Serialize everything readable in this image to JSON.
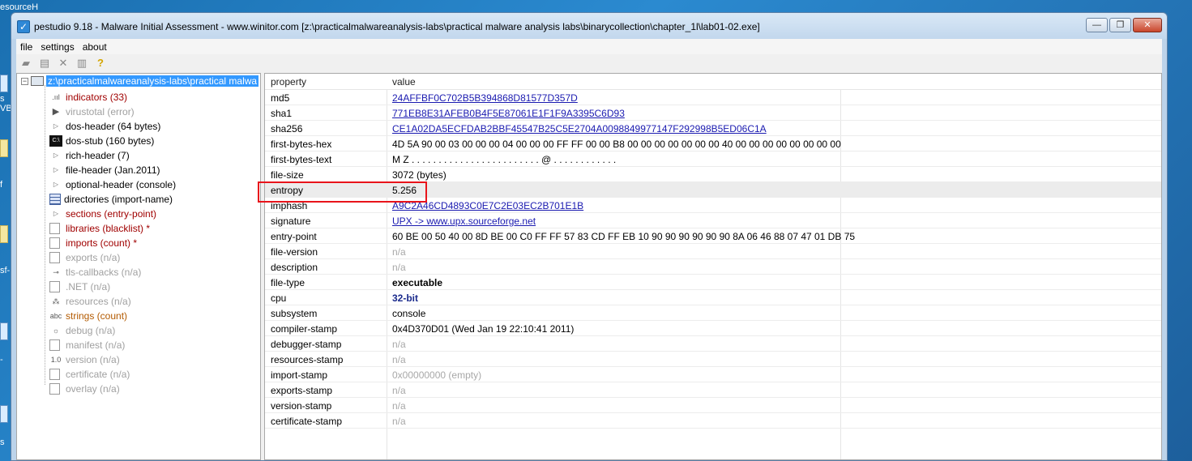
{
  "desktop": {
    "top_label": "esourceH",
    "side_labels": [
      "s",
      "VB",
      "f",
      "sf-",
      "-",
      "-",
      "s"
    ]
  },
  "window": {
    "title": "pestudio 9.18 - Malware Initial Assessment - www.winitor.com [z:\\practicalmalwareanalysis-labs\\practical malware analysis labs\\binarycollection\\chapter_1l\\lab01-02.exe]",
    "min_glyph": "—",
    "max_glyph": "❐",
    "close_glyph": "✕"
  },
  "menu": {
    "items": [
      "file",
      "settings",
      "about"
    ]
  },
  "toolbar": {
    "icons": [
      "open-icon",
      "save-icon",
      "close-file-icon",
      "clipboard-icon",
      "help-icon"
    ],
    "glyphs": [
      "▰",
      "▤",
      "✕",
      "▥",
      "?"
    ]
  },
  "tree": {
    "root_label": "z:\\practicalmalwareanalysis-labs\\practical malwa",
    "root_expander": "−",
    "items": [
      {
        "label": "indicators (33)",
        "color": "red",
        "icon": "bar-chart-icon",
        "glyph": ".ııl"
      },
      {
        "label": "virustotal (error)",
        "color": "gray",
        "icon": "virustotal-icon",
        "glyph": "▶"
      },
      {
        "label": "dos-header (64 bytes)",
        "color": "black",
        "icon": "chevron-right-icon",
        "glyph": "▷"
      },
      {
        "label": "dos-stub (160 bytes)",
        "color": "black",
        "icon": "console-icon",
        "glyph": "C:\\"
      },
      {
        "label": "rich-header (7)",
        "color": "black",
        "icon": "chevron-right-icon",
        "glyph": "▷"
      },
      {
        "label": "file-header (Jan.2011)",
        "color": "black",
        "icon": "chevron-right-icon",
        "glyph": "▷"
      },
      {
        "label": "optional-header (console)",
        "color": "black",
        "icon": "chevron-right-icon",
        "glyph": "▷"
      },
      {
        "label": "directories (import-name)",
        "color": "black",
        "icon": "grid-icon",
        "glyph": ""
      },
      {
        "label": "sections (entry-point)",
        "color": "red",
        "icon": "chevron-right-icon",
        "glyph": "▷"
      },
      {
        "label": "libraries (blacklist) *",
        "color": "red",
        "icon": "library-icon",
        "glyph": ""
      },
      {
        "label": "imports (count) *",
        "color": "red",
        "icon": "import-icon",
        "glyph": ""
      },
      {
        "label": "exports (n/a)",
        "color": "gray",
        "icon": "export-icon",
        "glyph": ""
      },
      {
        "label": "tls-callbacks (n/a)",
        "color": "gray",
        "icon": "key-icon",
        "glyph": "⊸"
      },
      {
        "label": ".NET (n/a)",
        "color": "gray",
        "icon": "dotnet-icon",
        "glyph": ""
      },
      {
        "label": "resources (n/a)",
        "color": "gray",
        "icon": "resources-icon",
        "glyph": "⁂"
      },
      {
        "label": "strings (count)",
        "color": "orange",
        "icon": "abc-icon",
        "glyph": "abc"
      },
      {
        "label": "debug (n/a)",
        "color": "gray",
        "icon": "bug-icon",
        "glyph": "☼"
      },
      {
        "label": "manifest (n/a)",
        "color": "gray",
        "icon": "manifest-icon",
        "glyph": ""
      },
      {
        "label": "version (n/a)",
        "color": "gray",
        "icon": "version-icon",
        "glyph": "1.0"
      },
      {
        "label": "certificate (n/a)",
        "color": "gray",
        "icon": "certificate-icon",
        "glyph": ""
      },
      {
        "label": "overlay (n/a)",
        "color": "gray",
        "icon": "overlay-icon",
        "glyph": ""
      }
    ]
  },
  "table": {
    "headers": [
      "property",
      "value"
    ],
    "rows": [
      {
        "prop": "md5",
        "val": "24AFFBF0C702B5B394868D81577D357D",
        "style": "link"
      },
      {
        "prop": "sha1",
        "val": "771EB8E31AFEB0B4F5E87061E1F1F9A3395C6D93",
        "style": "link"
      },
      {
        "prop": "sha256",
        "val": "CE1A02DA5ECFDAB2BBF45547B25C5E2704A0098849977147F292998B5ED06C1A",
        "style": "link"
      },
      {
        "prop": "first-bytes-hex",
        "val": "4D 5A 90 00 03 00 00 00 04 00 00 00 FF FF 00 00 B8 00 00 00 00 00 00 00 40 00 00 00 00 00 00 00 00",
        "style": "plain"
      },
      {
        "prop": "first-bytes-text",
        "val": "M Z . . . . . . . . . . . . . . . . . . . . . . . . @ . . . . . . . . . . . .",
        "style": "plain"
      },
      {
        "prop": "file-size",
        "val": "3072 (bytes)",
        "style": "plain"
      },
      {
        "prop": "entropy",
        "val": "5.256",
        "style": "plain"
      },
      {
        "prop": "imphash",
        "val": "A9C2A46CD4893C0E7C2E03EC2B701E1B",
        "style": "link"
      },
      {
        "prop": "signature",
        "val": "UPX -> www.upx.sourceforge.net",
        "style": "link"
      },
      {
        "prop": "entry-point",
        "val": "60 BE 00 50 40 00 8D BE 00 C0 FF FF 57 83 CD FF EB 10 90 90 90 90 90 90 8A 06 46 88 07 47 01 DB 75",
        "style": "plain"
      },
      {
        "prop": "file-version",
        "val": "n/a",
        "style": "na"
      },
      {
        "prop": "description",
        "val": "n/a",
        "style": "na"
      },
      {
        "prop": "file-type",
        "val": "executable",
        "style": "bold"
      },
      {
        "prop": "cpu",
        "val": "32-bit",
        "style": "blue-bold"
      },
      {
        "prop": "subsystem",
        "val": "console",
        "style": "plain"
      },
      {
        "prop": "compiler-stamp",
        "val": "0x4D370D01 (Wed Jan 19 22:10:41 2011)",
        "style": "plain"
      },
      {
        "prop": "debugger-stamp",
        "val": "n/a",
        "style": "na"
      },
      {
        "prop": "resources-stamp",
        "val": "n/a",
        "style": "na"
      },
      {
        "prop": "import-stamp",
        "val": "0x00000000 (empty)",
        "style": "na"
      },
      {
        "prop": "exports-stamp",
        "val": "n/a",
        "style": "na"
      },
      {
        "prop": "version-stamp",
        "val": "n/a",
        "style": "na"
      },
      {
        "prop": "certificate-stamp",
        "val": "n/a",
        "style": "na"
      }
    ],
    "selected_index": 6
  }
}
